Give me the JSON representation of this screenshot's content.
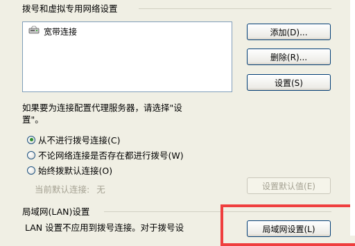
{
  "dialup_section": {
    "title": "拨号和虚拟专用网络设置",
    "connections": [
      {
        "name": "宽带连接",
        "icon": "broadband-connection-icon"
      }
    ],
    "add_label": "添加(D)...",
    "remove_label": "删除(R)...",
    "settings_label": "设置(S)",
    "proxy_hint_line1": "如果要为连接配置代理服务器，请选择\"设",
    "proxy_hint_line2": "置\"。",
    "radio_options": [
      {
        "label": "从不进行拨号连接(C)",
        "checked": true
      },
      {
        "label": "不论网络连接是否存在都进行拨号(W)",
        "checked": false
      },
      {
        "label": "始终拨默认连接(O)",
        "checked": false
      }
    ],
    "current_default_label": "当前默认连接:",
    "current_default_value": "无",
    "set_default_label": "设置默认值(E)"
  },
  "lan_section": {
    "title": "局域网(LAN)设置",
    "desc_line1": "LAN 设置不应用到拨号连接。对于拨号设",
    "lan_settings_label": "局域网设置(L)"
  },
  "colors": {
    "dialog_bg": "#f0efe4",
    "button_border": "#003c74",
    "highlight": "#ef3e3e"
  }
}
